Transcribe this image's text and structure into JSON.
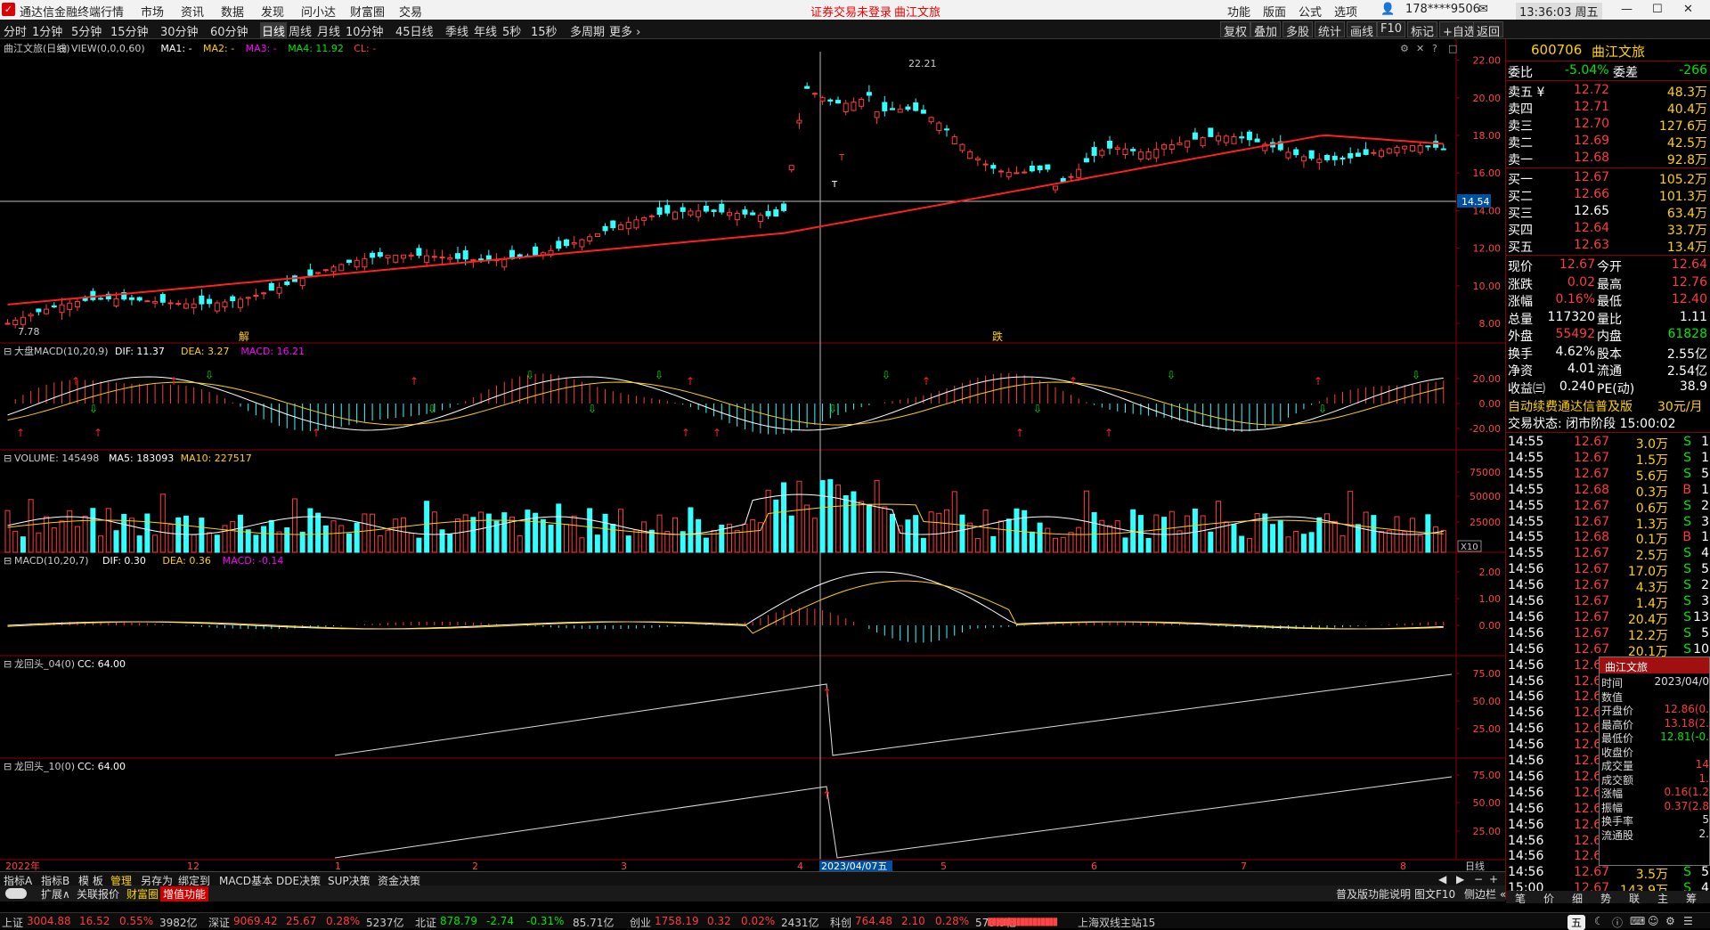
{
  "app": {
    "name": "通达信金融终端",
    "menus": [
      "行情",
      "市场",
      "资讯",
      "数据",
      "发现",
      "问小达",
      "财富圈",
      "交易"
    ],
    "notice": "证券交易未登录",
    "stock_title": "曲江文旅",
    "right_menus": [
      "功能",
      "版面",
      "公式",
      "选项"
    ],
    "account": "178****9506",
    "clock": "13:36:03 周五"
  },
  "toolbar": {
    "timeframes": [
      "分时",
      "1分钟",
      "5分钟",
      "15分钟",
      "30分钟",
      "60分钟",
      "日线",
      "周线",
      "月线",
      "10分钟",
      "45日线",
      "季线",
      "年线",
      "5秒",
      "15秒",
      "多周期",
      "更多 ›"
    ],
    "active": "日线",
    "right_buttons": [
      "复权",
      "叠加",
      "多股",
      "统计",
      "画线",
      "F10",
      "标记",
      "+自选",
      "返回"
    ]
  },
  "panels": {
    "main": {
      "title": "曲江文旅(日线)",
      "indicators": [
        {
          "t": "VIEW(0,0,0,60)",
          "c": "#ccc"
        },
        {
          "t": "MA1: -",
          "c": "#fff"
        },
        {
          "t": "MA2: -",
          "c": "#ffd200"
        },
        {
          "t": "MA3: -",
          "c": "#ff00ff"
        },
        {
          "t": "MA4: 11.92",
          "c": "#00e600"
        },
        {
          "t": "CL: -",
          "c": "#ff3b3b"
        }
      ],
      "y_ticks": [
        "22.00",
        "20.00",
        "18.00",
        "16.00",
        "14.00",
        "12.00",
        "10.00",
        "8.00"
      ],
      "high_label": "22.21",
      "low_label": "7.78",
      "cursor_price": "14.54",
      "markers": [
        {
          "t": "解"
        },
        {
          "t": "跌"
        }
      ],
      "t_markers": [
        "T",
        "T"
      ]
    },
    "macd1": {
      "title": "大盘MACD(10,20,9)",
      "indicators": [
        {
          "t": "DIF: 11.37",
          "c": "#fff"
        },
        {
          "t": "DEA: 3.27",
          "c": "#ffd200"
        },
        {
          "t": "MACD: 16.21",
          "c": "#ff00ff"
        }
      ],
      "y_ticks": [
        "20.00",
        "0.00",
        "-20.00"
      ]
    },
    "volume": {
      "title": "VOLUME: 145498",
      "indicators": [
        {
          "t": "MA5: 183093",
          "c": "#fff"
        },
        {
          "t": "MA10: 227517",
          "c": "#ffd200"
        }
      ],
      "y_ticks": [
        "75000",
        "50000",
        "25000"
      ],
      "unit": "X10"
    },
    "macd2": {
      "title": "MACD(10,20,7)",
      "indicators": [
        {
          "t": "DIF: 0.30",
          "c": "#fff"
        },
        {
          "t": "DEA: 0.36",
          "c": "#ffd200"
        },
        {
          "t": "MACD: -0.14",
          "c": "#ff00ff"
        }
      ],
      "y_ticks": [
        "2.00",
        "1.00",
        "0.00"
      ]
    },
    "lht04": {
      "title": "龙回头_04(0)",
      "indicators": [
        {
          "t": "CC: 64.00",
          "c": "#fff"
        }
      ],
      "y_ticks": [
        "75.00",
        "50.00",
        "25.00"
      ]
    },
    "lht10": {
      "title": "龙回头_10(0)",
      "indicators": [
        {
          "t": "CC: 64.00",
          "c": "#fff"
        }
      ],
      "y_ticks": [
        "75.00",
        "50.00",
        "25.00"
      ]
    }
  },
  "x_axis": {
    "labels": [
      "2022年",
      "12",
      "1",
      "2",
      "3",
      "4",
      "5",
      "6",
      "7",
      "8"
    ],
    "cursor_date": "2023/04/07五",
    "period": "日线"
  },
  "bottom": {
    "tabs1": [
      "指标A",
      "指标B",
      "模 板",
      "管理",
      "另存为",
      "绑定到",
      "MACD基本",
      "DDE决策",
      "SUP决策",
      "资金决策"
    ],
    "tabs2": [
      "扩展∧",
      "关联报价",
      "财富圈",
      "增值功能"
    ],
    "right_info": [
      "普及版功能说明",
      "图文F10",
      "侧边栏 «"
    ]
  },
  "quote": {
    "code": "600706",
    "name": "曲江文旅",
    "wb_label": "委比",
    "wb": "-5.04%",
    "wc_label": "委差",
    "wc": "-266",
    "asks": [
      {
        "l": "卖五 ¥",
        "p": "12.72",
        "v": "48.3万"
      },
      {
        "l": "卖四",
        "p": "12.71",
        "v": "40.4万"
      },
      {
        "l": "卖三",
        "p": "12.70",
        "v": "127.6万"
      },
      {
        "l": "卖二",
        "p": "12.69",
        "v": "42.5万"
      },
      {
        "l": "卖一",
        "p": "12.68",
        "v": "92.8万"
      }
    ],
    "bids": [
      {
        "l": "买一",
        "p": "12.67",
        "v": "105.2万"
      },
      {
        "l": "买二",
        "p": "12.66",
        "v": "101.3万"
      },
      {
        "l": "买三",
        "p": "12.65",
        "v": "63.4万"
      },
      {
        "l": "买四",
        "p": "12.64",
        "v": "33.7万"
      },
      {
        "l": "买五",
        "p": "12.63",
        "v": "13.4万"
      }
    ],
    "stats": [
      {
        "a": "现价",
        "b": "12.67",
        "c": "今开",
        "d": "12.64"
      },
      {
        "a": "涨跌",
        "b": "0.02",
        "c": "最高",
        "d": "12.76"
      },
      {
        "a": "涨幅",
        "b": "0.16%",
        "c": "最低",
        "d": "12.40"
      },
      {
        "a": "总量",
        "b": "117320",
        "c": "量比",
        "d": "1.11"
      },
      {
        "a": "外盘",
        "b": "55492",
        "c": "内盘",
        "d": "61828"
      },
      {
        "a": "换手",
        "b": "4.62%",
        "c": "股本",
        "d": "2.55亿"
      },
      {
        "a": "净资",
        "b": "4.01",
        "c": "流通",
        "d": "2.54亿"
      },
      {
        "a": "收益㈢",
        "b": "0.240",
        "c": "PE(动)",
        "d": "38.9"
      }
    ],
    "promo": "自动续费通达信普及版",
    "promo_price": "30元/月",
    "trade_status": "交易状态: 闭市阶段 15:00:02",
    "ticks": [
      [
        "14:55",
        "12.67",
        "3.0万",
        "S",
        "1"
      ],
      [
        "14:55",
        "12.67",
        "1.5万",
        "S",
        "1"
      ],
      [
        "14:55",
        "12.67",
        "5.6万",
        "S",
        "5"
      ],
      [
        "14:55",
        "12.68",
        "0.3万",
        "B",
        "1"
      ],
      [
        "14:55",
        "12.67",
        "0.6万",
        "S",
        "2"
      ],
      [
        "14:55",
        "12.67",
        "1.3万",
        "S",
        "3"
      ],
      [
        "14:55",
        "12.68",
        "0.1万",
        "B",
        "1"
      ],
      [
        "14:55",
        "12.67",
        "2.5万",
        "S",
        "4"
      ],
      [
        "14:56",
        "12.67",
        "17.0万",
        "S",
        "5"
      ],
      [
        "14:56",
        "12.67",
        "4.3万",
        "S",
        "2"
      ],
      [
        "14:56",
        "12.67",
        "1.4万",
        "S",
        "3"
      ],
      [
        "14:56",
        "12.67",
        "20.4万",
        "S",
        "13"
      ],
      [
        "14:56",
        "12.67",
        "12.2万",
        "S",
        "5"
      ],
      [
        "14:56",
        "12.67",
        "20.1万",
        "S",
        "10"
      ],
      [
        "14:56",
        "12.68",
        "2.9万",
        "B",
        "2"
      ],
      [
        "14:56",
        "12.6",
        "",
        ""
      ],
      [
        "14:56",
        "12.6",
        "",
        ""
      ],
      [
        "14:56",
        "12.6",
        "",
        ""
      ],
      [
        "14:56",
        "12.6",
        "",
        ""
      ],
      [
        "14:56",
        "12.6",
        "",
        ""
      ],
      [
        "14:56",
        "12.6",
        "",
        ""
      ],
      [
        "14:56",
        "12.6",
        "",
        ""
      ],
      [
        "14:56",
        "12.6",
        "",
        ""
      ],
      [
        "14:56",
        "12.6",
        "",
        ""
      ],
      [
        "14:56",
        "12.6",
        "",
        ""
      ],
      [
        "14:56",
        "12.6",
        "",
        ""
      ],
      [
        "14:56",
        "12.6",
        "",
        ""
      ],
      [
        "14:56",
        "12.67",
        "3.5万",
        "S",
        "5"
      ],
      [
        "15:00",
        "12.67",
        "143.9万",
        "S",
        "4"
      ]
    ],
    "tabs": [
      "笔",
      "价",
      "细",
      "势",
      "联",
      "主",
      "筹"
    ]
  },
  "popup": {
    "title": "曲江文旅",
    "rows": [
      [
        "时间",
        "2023/04/0"
      ],
      [
        "数值",
        ""
      ],
      [
        "开盘价",
        "12.86(0."
      ],
      [
        "最高价",
        "13.18(2."
      ],
      [
        "最低价",
        "12.81(-0."
      ],
      [
        "收盘价",
        ""
      ],
      [
        "成交量",
        "14"
      ],
      [
        "成交额",
        "1."
      ],
      [
        "涨幅",
        "0.16(1.2"
      ],
      [
        "振幅",
        "0.37(2.8"
      ],
      [
        "换手率",
        "5"
      ],
      [
        "流通股",
        "2."
      ]
    ]
  },
  "status": {
    "items": [
      {
        "t": "上证",
        "c": "#ccc"
      },
      {
        "t": "3004.88",
        "c": "#ff3b3b"
      },
      {
        "t": "16.52",
        "c": "#ff3b3b"
      },
      {
        "t": "0.55%",
        "c": "#ff3b3b"
      },
      {
        "t": "3982亿",
        "c": "#ccc"
      },
      {
        "t": "深证",
        "c": "#ccc"
      },
      {
        "t": "9069.42",
        "c": "#ff3b3b"
      },
      {
        "t": "25.67",
        "c": "#ff3b3b"
      },
      {
        "t": "0.28%",
        "c": "#ff3b3b"
      },
      {
        "t": "5237亿",
        "c": "#ccc"
      },
      {
        "t": "北证",
        "c": "#ccc"
      },
      {
        "t": "878.79",
        "c": "#00e600"
      },
      {
        "t": "-2.74",
        "c": "#00e600"
      },
      {
        "t": "-0.31%",
        "c": "#00e600"
      },
      {
        "t": "85.71亿",
        "c": "#ccc"
      },
      {
        "t": "创业",
        "c": "#ccc"
      },
      {
        "t": "1758.19",
        "c": "#ff3b3b"
      },
      {
        "t": "0.32",
        "c": "#ff3b3b"
      },
      {
        "t": "0.02%",
        "c": "#ff3b3b"
      },
      {
        "t": "2431亿",
        "c": "#ccc"
      },
      {
        "t": "科创",
        "c": "#ccc"
      },
      {
        "t": "764.48",
        "c": "#ff3b3b"
      },
      {
        "t": "2.10",
        "c": "#ff3b3b"
      },
      {
        "t": "0.28%",
        "c": "#ff3b3b"
      },
      {
        "t": "573.9亿",
        "c": "#ccc"
      }
    ],
    "server": "上海双线主站15",
    "ime": "五"
  }
}
